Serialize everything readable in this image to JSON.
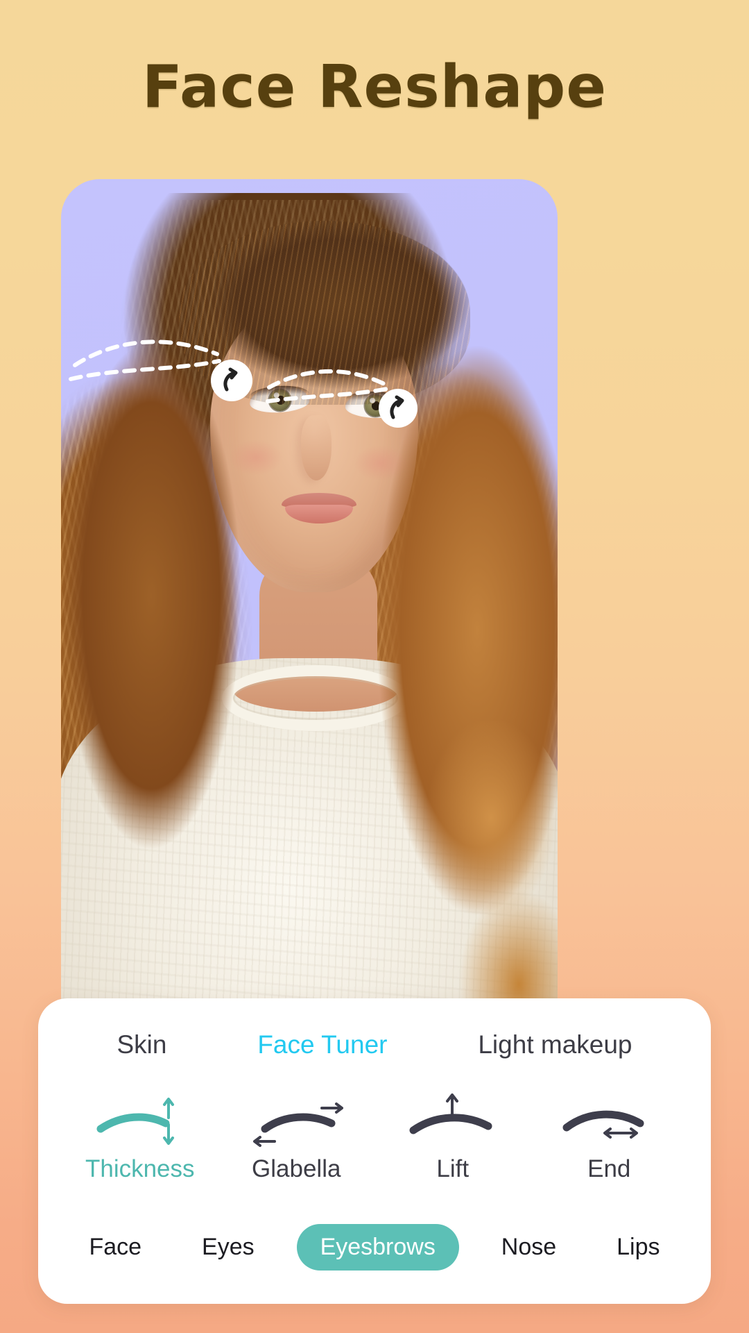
{
  "page": {
    "title": "Face Reshape",
    "background_top_color": "#F5D79A",
    "background_bottom_color": "#F5A984"
  },
  "photo": {
    "backdrop_color": "#C2C1FC",
    "overlay": {
      "name": "eyebrow-guide-overlay",
      "stroke_color": "#FFFFFF",
      "handle_fill": "#FFFFFF",
      "handle_arrow_color": "#222222"
    }
  },
  "panel": {
    "background_color": "#FFFFFF",
    "top_tabs": [
      {
        "id": "skin",
        "label": "Skin",
        "active": false
      },
      {
        "id": "face-tuner",
        "label": "Face Tuner",
        "active": true
      },
      {
        "id": "light-makeup",
        "label": "Light makeup",
        "active": false
      }
    ],
    "tools": [
      {
        "id": "thickness",
        "label": "Thickness",
        "icon": "brow-thickness-icon",
        "active": true
      },
      {
        "id": "glabella",
        "label": "Glabella",
        "icon": "brow-glabella-icon",
        "active": false
      },
      {
        "id": "lift",
        "label": "Lift",
        "icon": "brow-lift-icon",
        "active": false
      },
      {
        "id": "end",
        "label": "End",
        "icon": "brow-end-icon",
        "active": false
      }
    ],
    "categories": [
      {
        "id": "face",
        "label": "Face",
        "active": false
      },
      {
        "id": "eyes",
        "label": "Eyes",
        "active": false
      },
      {
        "id": "eyesbrows",
        "label": "Eyesbrows",
        "active": true
      },
      {
        "id": "nose",
        "label": "Nose",
        "active": false
      },
      {
        "id": "lips",
        "label": "Lips",
        "active": false
      }
    ],
    "colors": {
      "active_tab_cyan": "#22C9F0",
      "active_tool_teal": "#4DB7AE",
      "active_pill_teal": "#5CC0B6",
      "inactive_text": "#3D3D46"
    }
  }
}
